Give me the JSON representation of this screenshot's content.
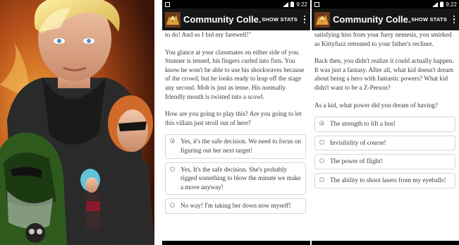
{
  "status_bar": {
    "time": "9:22"
  },
  "app_bar": {
    "title": "Community Colle...",
    "stats_label": "SHOW STATS"
  },
  "screen_left": {
    "paragraphs": [
      "to do! And so I bid my farewell!\"",
      "You glance at your classmates on either side of you. Stunner is tensed, his fingers curled into fists. You know he won't be able to use his shockwaves because of the crowd, but he looks ready to leap off the stage any second. Mob is just as tense. His normally friendly mouth is twisted into a scowl.",
      "How are you going to play this? Are you going to let this villain just stroll out of here?"
    ],
    "options": [
      {
        "label": "Yes, it's the safe decision. We need to focus on figuring out her next target!",
        "selected": true
      },
      {
        "label": "Yes, It's the safe decision. She's probably rigged something to blow the minute we make a move anyway!",
        "selected": false
      },
      {
        "label": "No way! I'm taking her down now myself!",
        "selected": false
      }
    ]
  },
  "screen_right": {
    "paragraphs": [
      "satisfying hiss from your furry nemesis, you smirked as Kittyfuzz retreated to your father's recliner.",
      "Back then, you didn't realize it could actually happen. It was just a fantasy. After all, what kid doesn't dream about being a hero with fantastic powers? What kid didn't want to be a Z-Person?",
      "As a kid, what power did you dream of having?"
    ],
    "options": [
      {
        "label": "The strength to lift a bus!",
        "selected": true
      },
      {
        "label": "Invisibility of course!",
        "selected": false
      },
      {
        "label": "The power of flight!",
        "selected": false
      },
      {
        "label": "The ability to shoot lasers from my eyeballs!",
        "selected": false
      }
    ]
  },
  "colors": {
    "app_bar": "#161616",
    "text": "#3a3a3a",
    "option_border": "#d7d7d7"
  }
}
